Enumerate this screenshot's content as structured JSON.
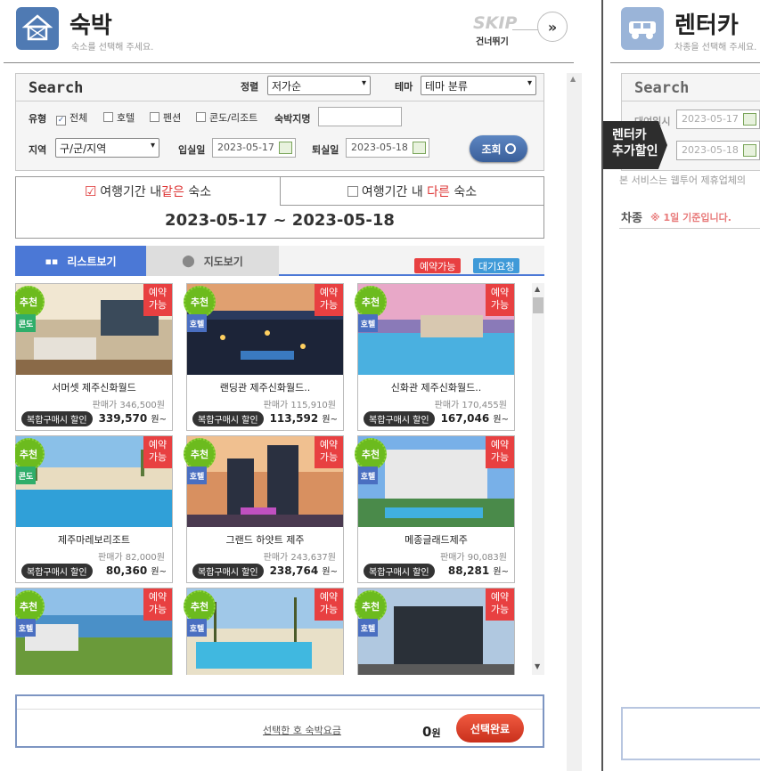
{
  "lodging": {
    "title": "숙박",
    "subtitle": "숙소를 선택해 주세요.",
    "skip_label": "SKIP",
    "skip_sub": "건너뛰기",
    "skip_arrow": "»"
  },
  "search": {
    "title": "Search",
    "sort_label": "정렬",
    "sort_value": "저가순",
    "theme_label": "테마",
    "theme_value": "테마 분류",
    "type_label": "유형",
    "types": [
      "전체",
      "호텔",
      "펜션",
      "콘도/리조트"
    ],
    "name_label": "숙박지명",
    "name_value": "",
    "region_label": "지역",
    "region_value": "구/군/지역",
    "checkin_label": "입실일",
    "checkin_value": "2023-05-17",
    "checkout_label": "퇴실일",
    "checkout_value": "2023-05-18",
    "search_button": "조회"
  },
  "period": {
    "same_prefix": "여행기간 내 ",
    "same_em": "같은",
    "same_suffix": " 숙소",
    "diff_prefix": "여행기간 내 ",
    "diff_em": "다른",
    "diff_suffix": " 숙소",
    "range": "2023-05-17 ~ 2023-05-18"
  },
  "tabs": {
    "list": "리스트보기",
    "map": "지도보기",
    "badge_available": "예약가능",
    "badge_waiting": "대기요청"
  },
  "cards": [
    {
      "rec": "추천",
      "type": "콘도",
      "type_color": "#2fae6a",
      "avail1": "예약",
      "avail2": "가능",
      "name": "서머셋 제주신화월드",
      "price": "판매가 346,500원",
      "disc": "복합구매시 할인",
      "final": "339,570",
      "unit": "원~",
      "img": "room"
    },
    {
      "rec": "추천",
      "type": "호텔",
      "type_color": "#4a6fc1",
      "avail1": "예약",
      "avail2": "가능",
      "name": "랜딩관 제주신화월드..",
      "price": "판매가 115,910원",
      "disc": "복합구매시 할인",
      "final": "113,592",
      "unit": "원~",
      "img": "night"
    },
    {
      "rec": "추천",
      "type": "호텔",
      "type_color": "#4a6fc1",
      "avail1": "예약",
      "avail2": "가능",
      "name": "신화관 제주신화월드..",
      "price": "판매가 170,455원",
      "disc": "복합구매시 할인",
      "final": "167,046",
      "unit": "원~",
      "img": "pool-dusk"
    },
    {
      "rec": "추천",
      "type": "콘도",
      "type_color": "#2fae6a",
      "avail1": "예약",
      "avail2": "가능",
      "name": "제주마레보리조트",
      "price": "판매가 82,000원",
      "disc": "복합구매시 할인",
      "final": "80,360",
      "unit": "원~",
      "img": "pool-day"
    },
    {
      "rec": "추천",
      "type": "호텔",
      "type_color": "#4a6fc1",
      "avail1": "예약",
      "avail2": "가능",
      "name": "그랜드 하얏트 제주",
      "price": "판매가 243,637원",
      "disc": "복합구매시 할인",
      "final": "238,764",
      "unit": "원~",
      "img": "tower"
    },
    {
      "rec": "추천",
      "type": "호텔",
      "type_color": "#4a6fc1",
      "avail1": "예약",
      "avail2": "가능",
      "name": "메종글래드제주",
      "price": "판매가 90,083원",
      "disc": "복합구매시 할인",
      "final": "88,281",
      "unit": "원~",
      "img": "building"
    },
    {
      "rec": "추천",
      "type": "호텔",
      "type_color": "#4a6fc1",
      "avail1": "예약",
      "avail2": "가능",
      "name": "",
      "price": "",
      "disc": "",
      "final": "",
      "unit": "",
      "img": "coast"
    },
    {
      "rec": "추천",
      "type": "호텔",
      "type_color": "#4a6fc1",
      "avail1": "예약",
      "avail2": "가능",
      "name": "",
      "price": "",
      "disc": "",
      "final": "",
      "unit": "",
      "img": "palm-pool"
    },
    {
      "rec": "추천",
      "type": "호텔",
      "type_color": "#4a6fc1",
      "avail1": "예약",
      "avail2": "가능",
      "name": "",
      "price": "",
      "disc": "",
      "final": "",
      "unit": "",
      "img": "dark-tower"
    }
  ],
  "footer": {
    "link": "선택한 호 숙박요금",
    "amount": "0",
    "unit": "원",
    "done": "선택완료"
  },
  "rental": {
    "title": "렌터카",
    "subtitle": "차종을 선택해 주세요.",
    "search_title": "Search",
    "rent_label": "대여일시",
    "rent_value": "2023-05-17",
    "return_value": "2023-05-18",
    "ribbon1": "렌터카",
    "ribbon2": "추가할인",
    "notice": "본 서비스는 웹투어 제휴업체의",
    "car_label": "차종",
    "car_note": "※ 1일 기준입니다."
  },
  "colors": {
    "accent": "#4b78d6",
    "red": "#e84041",
    "green": "#6cbb1e"
  }
}
